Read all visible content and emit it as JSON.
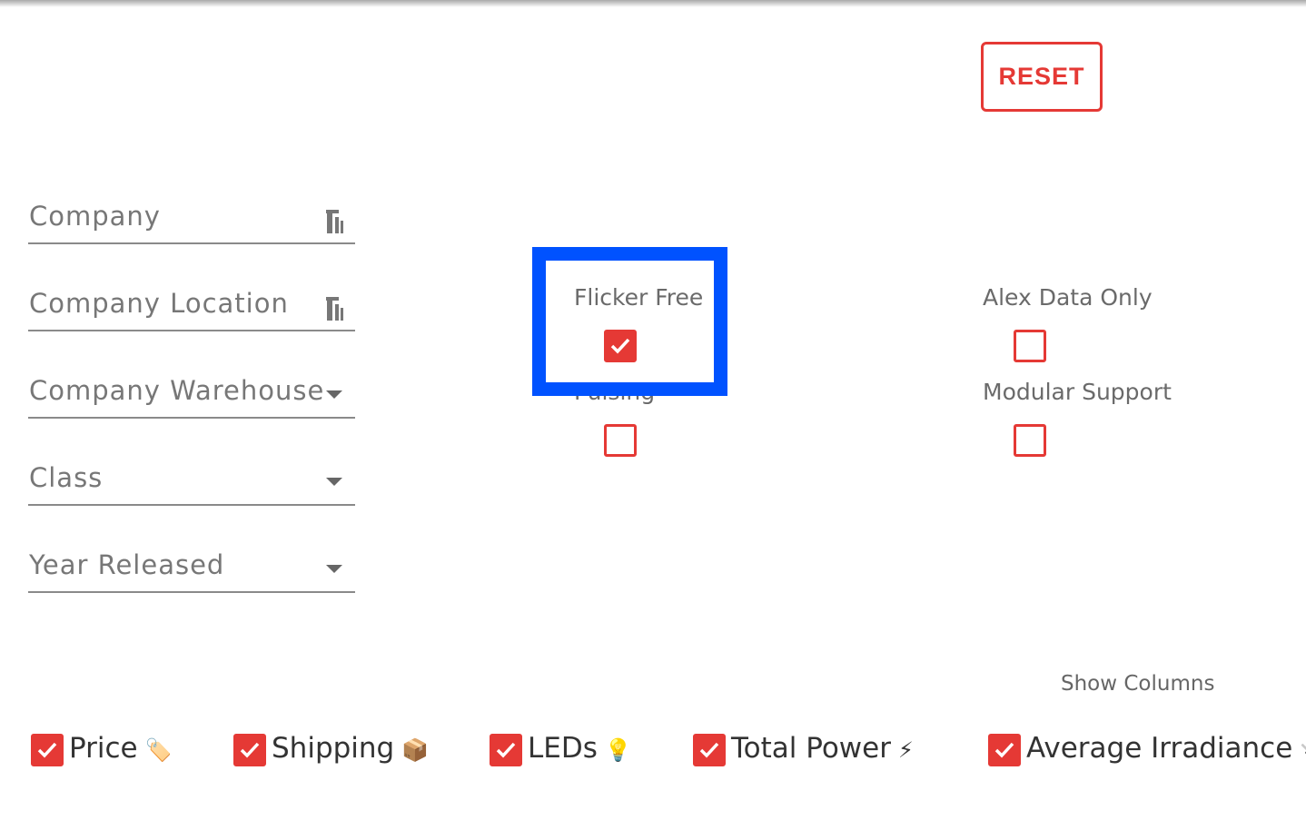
{
  "reset_label": "RESET",
  "filters": [
    {
      "label": "Company",
      "control": "tool"
    },
    {
      "label": "Company Location",
      "control": "tool"
    },
    {
      "label": "Company Warehouse",
      "control": "dropdown"
    },
    {
      "label": "Class",
      "control": "dropdown"
    },
    {
      "label": "Year Released",
      "control": "dropdown"
    }
  ],
  "checkboxes": {
    "flicker_free": {
      "label": "Flicker Free",
      "checked": true
    },
    "pulsing": {
      "label": "Pulsing",
      "checked": false
    },
    "alex_data_only": {
      "label": "Alex Data Only",
      "checked": false
    },
    "modular_support": {
      "label": "Modular Support",
      "checked": false
    }
  },
  "show_columns_label": "Show Columns",
  "columns": [
    {
      "label": "Price",
      "emoji": "🏷️",
      "checked": true
    },
    {
      "label": "Shipping",
      "emoji": "📦",
      "checked": true
    },
    {
      "label": "LEDs",
      "emoji": "💡",
      "checked": true
    },
    {
      "label": "Total Power",
      "emoji": "⚡",
      "checked": true
    },
    {
      "label": "Average Irradiance",
      "emoji": "🔌",
      "checked": true
    }
  ],
  "colors": {
    "accent": "#e53935",
    "highlight": "#0052ff"
  }
}
